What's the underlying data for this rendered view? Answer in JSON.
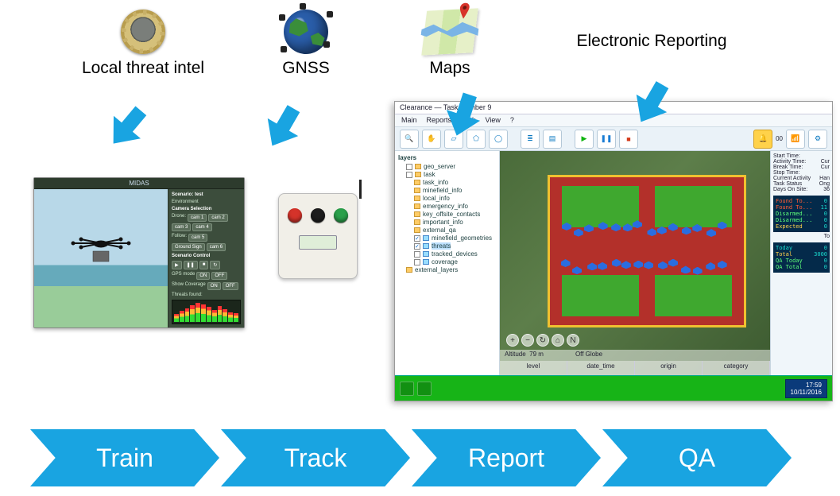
{
  "sources": [
    {
      "label": "Local threat intel",
      "icon": "landmine-icon"
    },
    {
      "label": "GNSS",
      "icon": "globe-icon"
    },
    {
      "label": "Maps",
      "icon": "folded-map-icon"
    },
    {
      "label": "Electronic Reporting",
      "icon": ""
    }
  ],
  "midas": {
    "title": "MIDAS",
    "scenario_heading": "Scenario: test",
    "environment_label": "Environment",
    "cam_heading": "Camera Selection",
    "drone_label": "Drone:",
    "drone_cams": [
      "cam 1",
      "cam 2",
      "cam 3",
      "cam 4"
    ],
    "follow_label": "Follow:",
    "follow_btns": [
      "cam 5",
      "Ground Sign",
      "cam 6"
    ],
    "scenario_ctrl_heading": "Scenario Control",
    "gps_label": "GPS mode",
    "coverage_label": "Show Coverage",
    "on_label": "ON",
    "off_label": "OFF",
    "threats_found_label": "Threats found:"
  },
  "gnss_device": {
    "buttons": [
      {
        "name": "red-button",
        "color": "#d5332a"
      },
      {
        "name": "black-button",
        "color": "#1d1d1d"
      },
      {
        "name": "green-button",
        "color": "#2aa04a"
      }
    ]
  },
  "report_app": {
    "window_title": "Clearance — Task Number 9",
    "menu": [
      "Main",
      "Reports",
      "Task",
      "View",
      "?"
    ],
    "toolbar_icons": [
      "search-icon",
      "hand-icon",
      "polygon-icon",
      "pentagon-icon",
      "circle-icon",
      "divider",
      "database-icon",
      "layers-icon",
      "divider",
      "play-icon",
      "pause-icon",
      "stop-icon"
    ],
    "toolbar_right": [
      "bell-icon",
      "signal-icon",
      "settings-icon"
    ],
    "bell_count": "00",
    "tree": {
      "root": "layers",
      "items": [
        {
          "label": "geo_server",
          "type": "folder",
          "checked": false
        },
        {
          "label": "task",
          "type": "folder",
          "checked": false,
          "children": [
            {
              "label": "task_info",
              "type": "folder"
            },
            {
              "label": "minefield_info",
              "type": "folder"
            },
            {
              "label": "local_info",
              "type": "folder"
            },
            {
              "label": "emergency_info",
              "type": "folder"
            },
            {
              "label": "key_offsite_contacts",
              "type": "folder"
            },
            {
              "label": "important_info",
              "type": "folder"
            },
            {
              "label": "external_qa",
              "type": "folder"
            },
            {
              "label": "minefield_geometries",
              "type": "layer",
              "checked": true
            },
            {
              "label": "threats",
              "type": "layer",
              "checked": true,
              "highlight": true
            },
            {
              "label": "tracked_devices",
              "type": "layer",
              "checked": false
            },
            {
              "label": "coverage",
              "type": "layer",
              "checked": false
            }
          ]
        },
        {
          "label": "external_layers",
          "type": "file"
        }
      ]
    },
    "map": {
      "status_altitude_label": "Altitude",
      "status_altitude_value": "79 m",
      "status_globe": "Off Globe",
      "columns": [
        "level",
        "date_time",
        "origin",
        "category"
      ],
      "controls": [
        "plus-icon",
        "minus-icon",
        "rotate-icon",
        "home-icon",
        "north-icon"
      ]
    },
    "right": {
      "fields": [
        {
          "k": "Start Time:",
          "v": ""
        },
        {
          "k": "Activity Time:",
          "v": "Cur"
        },
        {
          "k": "Break Time:",
          "v": "Cur"
        },
        {
          "k": "Stop Time:",
          "v": ""
        },
        {
          "k": "Current Activity",
          "v": "Han"
        },
        {
          "k": "Task Status",
          "v": "Ong"
        },
        {
          "k": "Days On Site:",
          "v": "36"
        }
      ],
      "stats1": [
        {
          "k": "Found To...",
          "v": "0"
        },
        {
          "k": "Found To...",
          "v": "11"
        },
        {
          "k": "Disarmed...",
          "v": "0"
        },
        {
          "k": "Disarmed...",
          "v": "0"
        },
        {
          "k": "Expected",
          "v": "0"
        }
      ],
      "stats2_hdr": "To",
      "stats2": [
        {
          "k": "Today",
          "v": "0"
        },
        {
          "k": "Total",
          "v": "3000"
        },
        {
          "k": "QA Today",
          "v": "0"
        },
        {
          "k": "QA Total",
          "v": "0"
        }
      ]
    },
    "taskbar": {
      "time": "17:59",
      "date": "10/11/2016"
    }
  },
  "process": [
    "Train",
    "Track",
    "Report",
    "QA"
  ],
  "colors": {
    "accent": "#19a4e1",
    "chevron": "#19a4e1"
  }
}
